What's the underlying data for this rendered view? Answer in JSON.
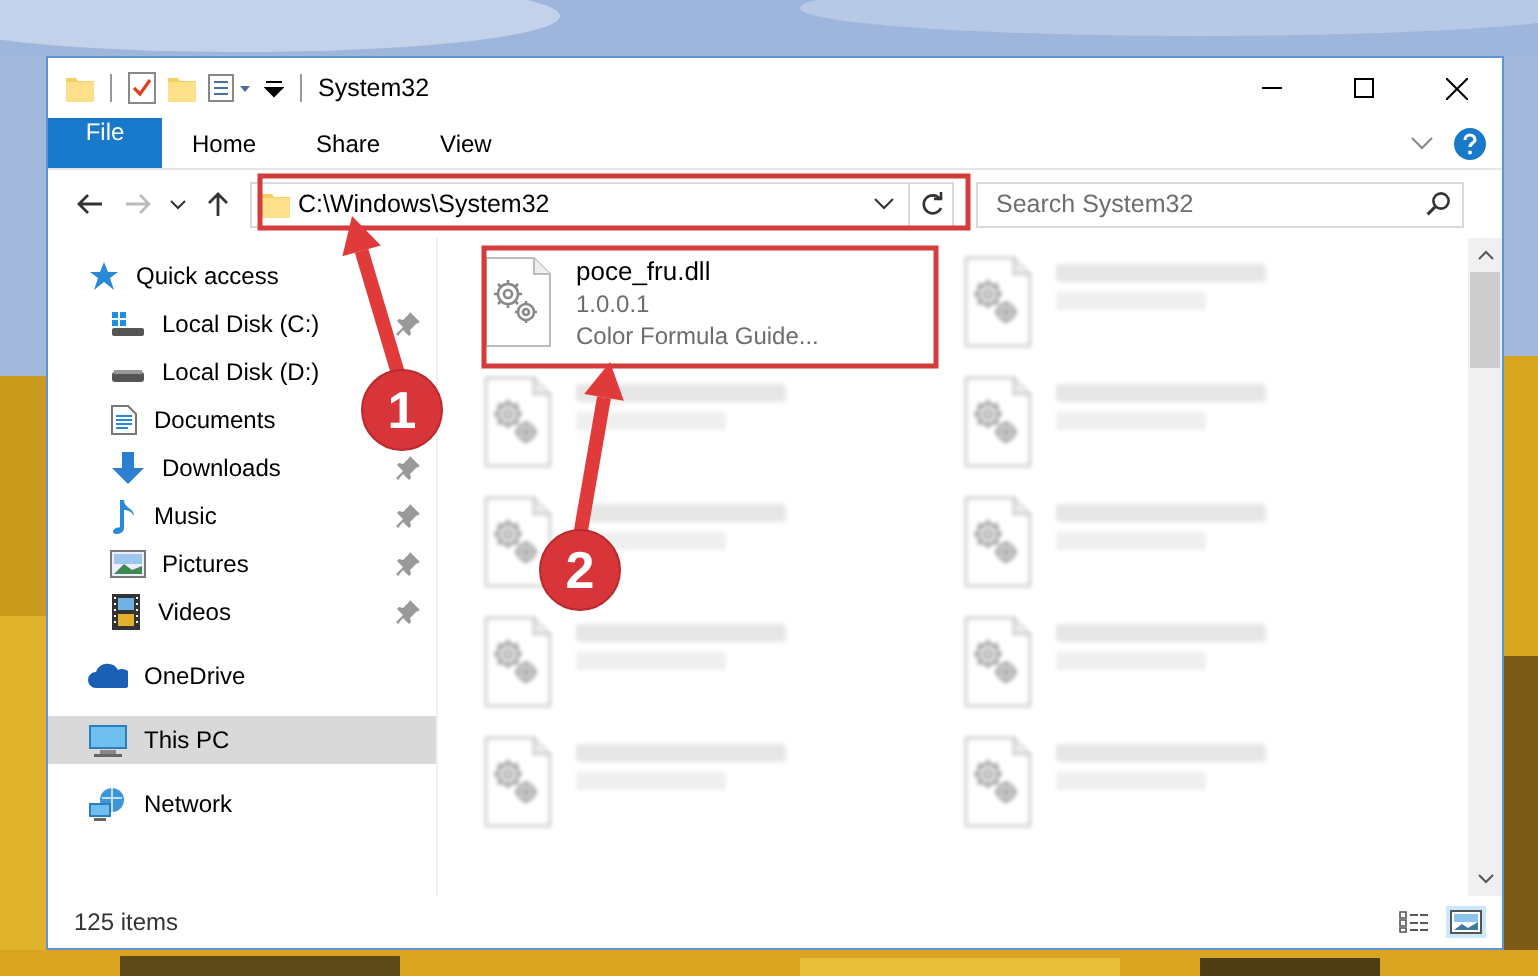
{
  "window": {
    "title": "System32"
  },
  "ribbon_tabs": [
    {
      "label": "File",
      "kind": "file"
    },
    {
      "label": "Home",
      "kind": "tab"
    },
    {
      "label": "Share",
      "kind": "tab"
    },
    {
      "label": "View",
      "kind": "tab"
    }
  ],
  "address": {
    "path": "C:\\Windows\\System32"
  },
  "search": {
    "placeholder": "Search System32"
  },
  "navigation": [
    {
      "label": "Quick access",
      "kind": "quick",
      "selected": false,
      "children": [
        {
          "label": "Local Disk (C:)",
          "kind": "system-drive",
          "pinned": true,
          "selected": false
        },
        {
          "label": "Local Disk (D:)",
          "kind": "drive",
          "pinned": false,
          "selected": false
        },
        {
          "label": "Documents",
          "kind": "documents",
          "selected": false
        },
        {
          "label": "Downloads",
          "kind": "downloads",
          "pinned": true,
          "selected": false
        },
        {
          "label": "Music",
          "kind": "music",
          "pinned": true,
          "selected": false
        },
        {
          "label": "Pictures",
          "kind": "pictures",
          "pinned": true,
          "selected": false
        },
        {
          "label": "Videos",
          "kind": "videos",
          "pinned": true,
          "selected": false
        }
      ]
    },
    {
      "label": "OneDrive",
      "kind": "cloud",
      "selected": false
    },
    {
      "label": "This PC",
      "kind": "pc",
      "selected": true
    },
    {
      "label": "Network",
      "kind": "network",
      "selected": false
    }
  ],
  "files": [
    {
      "name": "poce_fru.dll",
      "details": [
        "1.0.0.1",
        "Color Formula Guide..."
      ],
      "blurred": false
    },
    {
      "blurred": true
    },
    {
      "blurred": true
    },
    {
      "blurred": true
    },
    {
      "blurred": true
    },
    {
      "blurred": true
    },
    {
      "blurred": true
    },
    {
      "blurred": true
    },
    {
      "blurred": true
    },
    {
      "blurred": true
    }
  ],
  "status_bar": {
    "item_count": "125 items"
  },
  "annotations": [
    {
      "number": "1"
    },
    {
      "number": "2"
    }
  ]
}
